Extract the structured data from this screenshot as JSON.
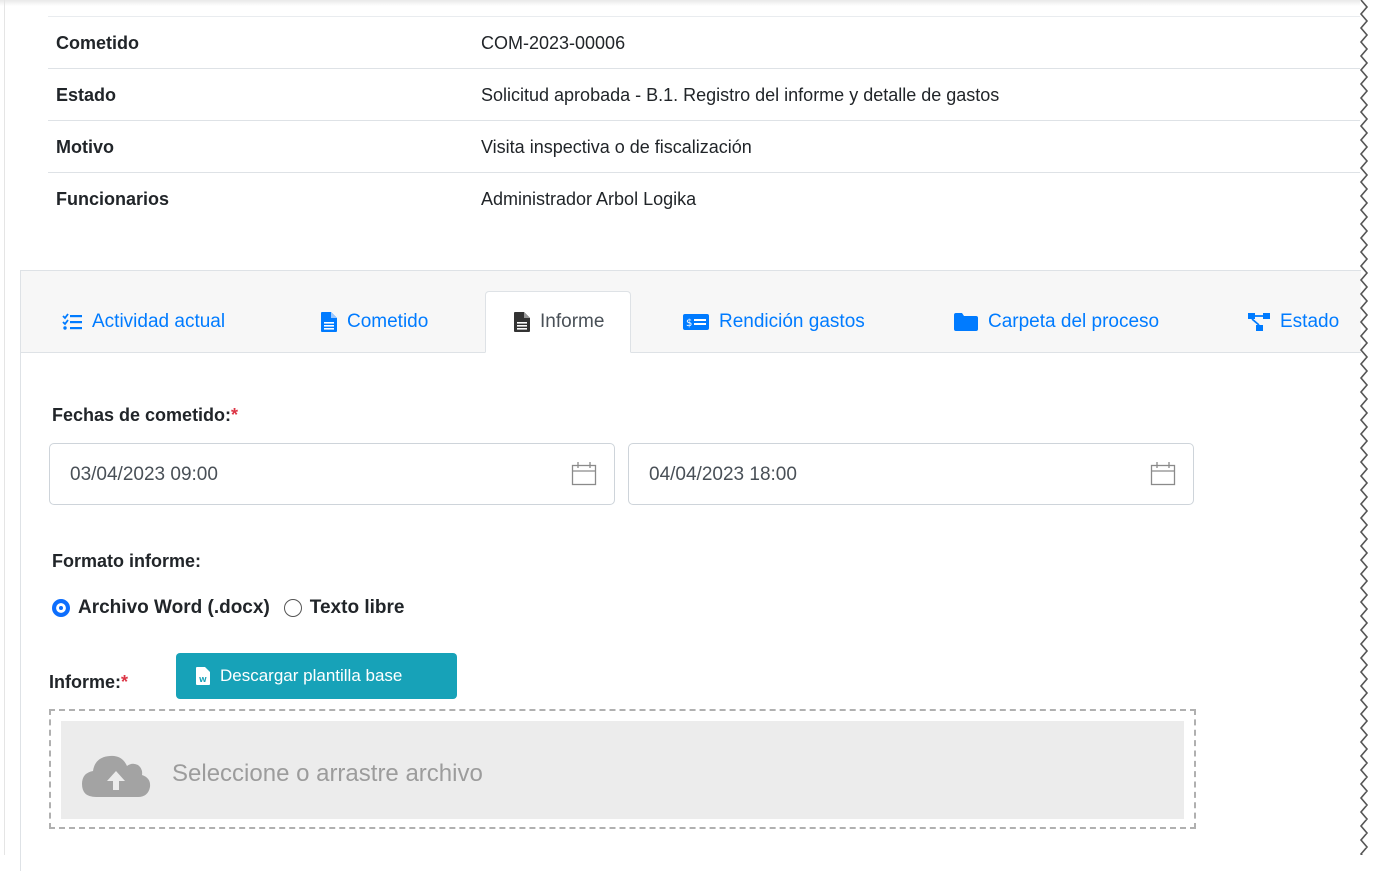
{
  "details": {
    "rows": [
      {
        "label": "Cometido",
        "value": "COM-2023-00006"
      },
      {
        "label": "Estado",
        "value": "Solicitud aprobada - B.1. Registro del informe y detalle de gastos"
      },
      {
        "label": "Motivo",
        "value": "Visita inspectiva o de fiscalización"
      },
      {
        "label": "Funcionarios",
        "value": "Administrador Arbol Logika"
      }
    ]
  },
  "tabs": {
    "active": "Informe",
    "items": [
      {
        "label": "Actividad actual",
        "icon": "list-check-icon"
      },
      {
        "label": "Cometido",
        "icon": "file-icon"
      },
      {
        "label": "Informe",
        "icon": "file-icon"
      },
      {
        "label": "Rendición gastos",
        "icon": "money-bill-icon"
      },
      {
        "label": "Carpeta del proceso",
        "icon": "folder-icon"
      },
      {
        "label": "Estado",
        "icon": "project-diagram-icon"
      }
    ]
  },
  "form": {
    "dates_label": "Fechas de cometido:",
    "required_mark": "*",
    "start_date": "03/04/2023 09:00",
    "end_date": "04/04/2023 18:00",
    "format_label": "Formato informe:",
    "format_options": [
      {
        "label": "Archivo Word (.docx)",
        "selected": true
      },
      {
        "label": "Texto libre",
        "selected": false
      }
    ],
    "report_label": "Informe:",
    "download_button": "Descargar plantilla base",
    "dropzone_text": "Seleccione o arrastre archivo"
  },
  "colors": {
    "link": "#007bff",
    "button_info": "#17a2b8",
    "required": "#dc3545",
    "radio_checked": "#0d6efd"
  }
}
